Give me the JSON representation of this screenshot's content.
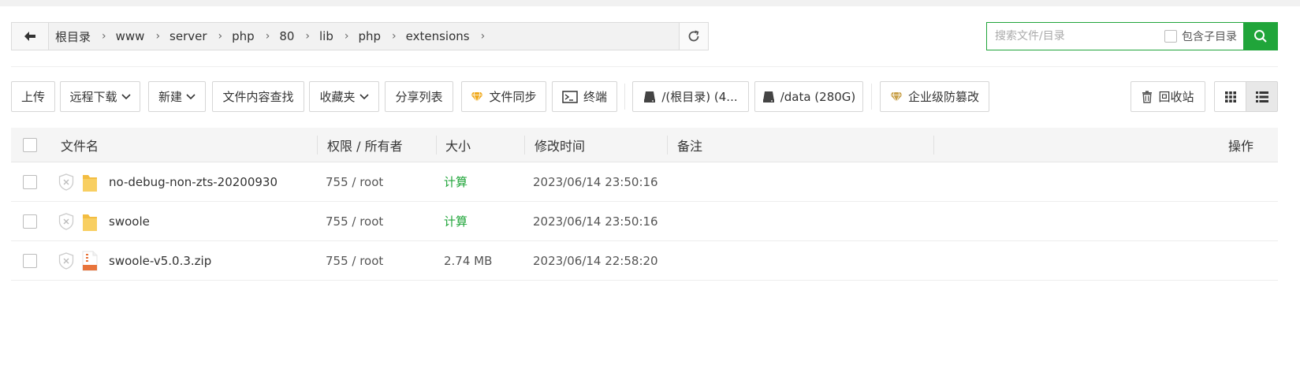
{
  "breadcrumb": [
    "根目录",
    "www",
    "server",
    "php",
    "80",
    "lib",
    "php",
    "extensions"
  ],
  "search": {
    "placeholder": "搜索文件/目录",
    "include_subdirs_label": "包含子目录"
  },
  "toolbar": {
    "upload": "上传",
    "remote_download": "远程下载",
    "new": "新建",
    "content_search": "文件内容查找",
    "favorites": "收藏夹",
    "share_list": "分享列表",
    "file_sync": "文件同步",
    "terminal": "终端",
    "disk_root": "/(根目录) (4...",
    "disk_data": "/data (280G)",
    "tamper_protect": "企业级防篡改",
    "recycle_bin": "回收站"
  },
  "table": {
    "headers": {
      "name": "文件名",
      "perm": "权限 / 所有者",
      "size": "大小",
      "mtime": "修改时间",
      "note": "备注",
      "ops": "操作"
    },
    "rows": [
      {
        "name": "no-debug-non-zts-20200930",
        "type": "folder",
        "perm": "755 / root",
        "size": "计算",
        "mtime": "2023/06/14 23:50:16",
        "note": ""
      },
      {
        "name": "swoole",
        "type": "folder",
        "perm": "755 / root",
        "size": "计算",
        "mtime": "2023/06/14 23:50:16",
        "note": ""
      },
      {
        "name": "swoole-v5.0.3.zip",
        "type": "zip",
        "perm": "755 / root",
        "size": "2.74 MB",
        "mtime": "2023/06/14 22:58:20",
        "note": ""
      }
    ]
  },
  "colors": {
    "accent": "#20a53a",
    "header_bg": "#f5f5f5",
    "folder": "#f7c14a",
    "diamond": "#e8a317"
  },
  "view_mode": "list"
}
